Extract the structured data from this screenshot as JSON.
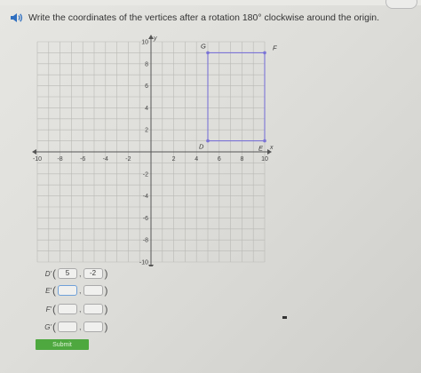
{
  "question": {
    "text": "Write the coordinates of the vertices after a rotation 180° clockwise around the origin."
  },
  "graph": {
    "x_range": [
      -10,
      10
    ],
    "y_range": [
      -10,
      10
    ],
    "x_tick_labels": [
      "-10",
      "-8",
      "-6",
      "-4",
      "-2",
      "2",
      "4",
      "6",
      "8",
      "10"
    ],
    "y_tick_labels": [
      "10",
      "8",
      "6",
      "4",
      "2",
      "-2",
      "-4",
      "-6",
      "-8",
      "-10"
    ],
    "x_axis_label": "x",
    "y_axis_label": "y",
    "shape_color": "#7b74d6",
    "vertices": [
      {
        "label": "D",
        "x": 5,
        "y": 1
      },
      {
        "label": "E",
        "x": 10,
        "y": 1
      },
      {
        "label": "F",
        "x": 10,
        "y": 9
      },
      {
        "label": "G",
        "x": 5,
        "y": 9
      }
    ]
  },
  "answers": [
    {
      "label": "D'",
      "x": "5",
      "y": "-2"
    },
    {
      "label": "E'",
      "x": "",
      "y": ""
    },
    {
      "label": "F'",
      "x": "",
      "y": ""
    },
    {
      "label": "G'",
      "x": "",
      "y": ""
    }
  ],
  "submit_label": "Submit",
  "colors": {
    "submit": "#4ea83f",
    "speaker": "#2f6fc0"
  }
}
